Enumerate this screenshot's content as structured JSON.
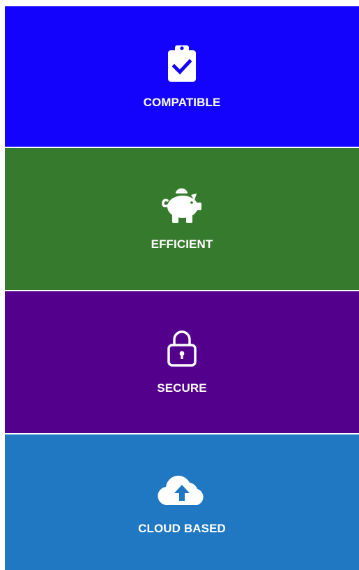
{
  "colors": {
    "compatible_bg": "#1303fd",
    "efficient_bg": "#367b2d",
    "secure_bg": "#53008d",
    "cloud_bg": "#1f78c1",
    "text": "#ffffff"
  },
  "features": [
    {
      "label": "COMPATIBLE",
      "icon": "clipboard-check-icon"
    },
    {
      "label": "EFFICIENT",
      "icon": "piggy-bank-icon"
    },
    {
      "label": "SECURE",
      "icon": "lock-icon"
    },
    {
      "label": "CLOUD BASED",
      "icon": "cloud-upload-icon"
    }
  ]
}
